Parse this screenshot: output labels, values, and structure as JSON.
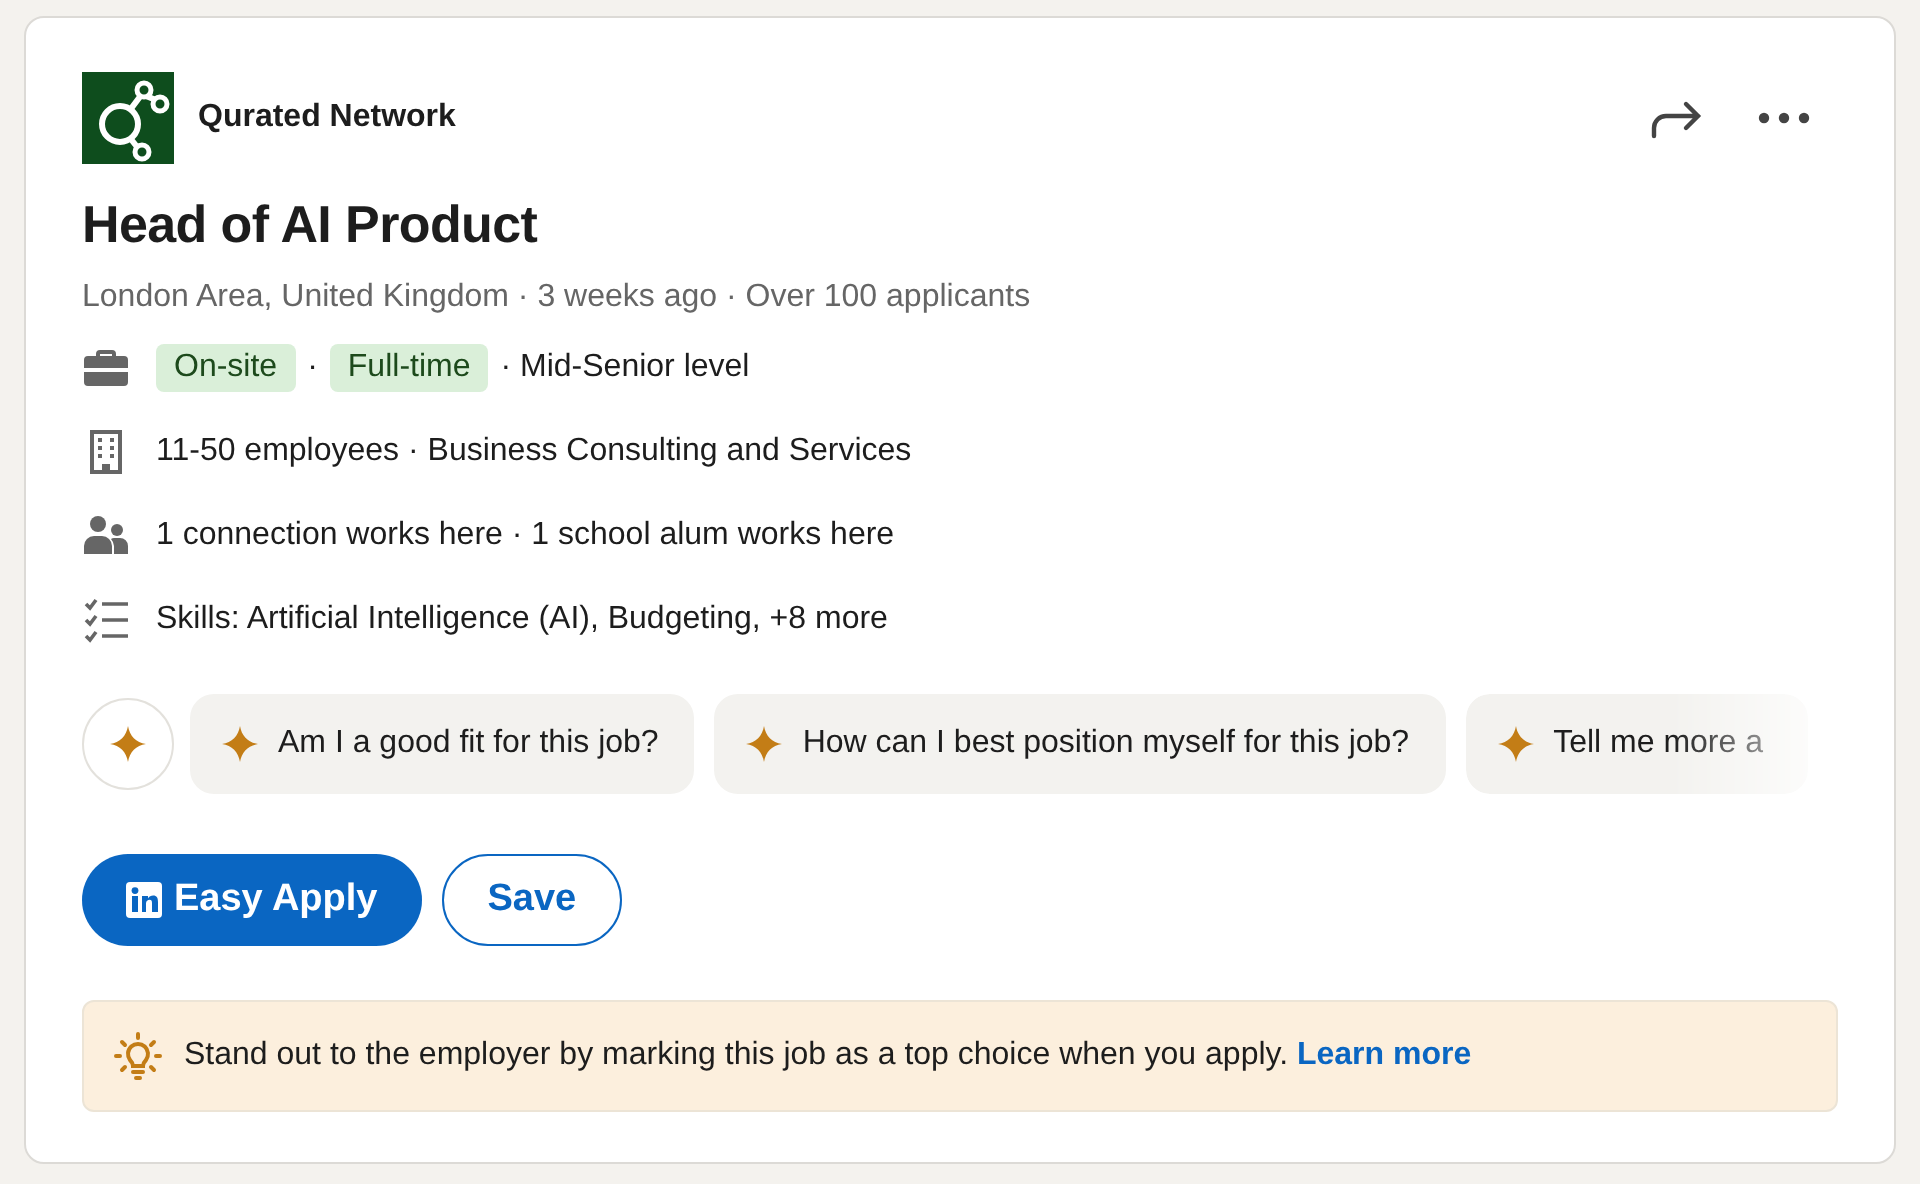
{
  "company": {
    "name": "Qurated Network"
  },
  "title": "Head of AI Product",
  "meta": "London Area, United Kingdom · 3 weeks ago · Over 100 applicants",
  "insights": [
    {
      "kind": "job-type",
      "parts": [
        {
          "text": "On-site",
          "tag": true
        },
        {
          "text": "·",
          "tag": false
        },
        {
          "text": "Full-time",
          "tag": true
        },
        {
          "text": "· Mid-Senior level",
          "tag": false
        }
      ]
    },
    {
      "kind": "company-size",
      "parts": [
        {
          "text": "11-50 employees · Business Consulting and Services",
          "tag": false
        }
      ]
    },
    {
      "kind": "connections",
      "parts": [
        {
          "text": "1 connection works here · 1 school alum works here",
          "tag": false
        }
      ]
    },
    {
      "kind": "skills",
      "parts": [
        {
          "text": "Skills: Artificial Intelligence (AI), Budgeting, +8 more",
          "tag": false
        }
      ]
    }
  ],
  "prompts": [
    {
      "text": "Am I a good fit for this job?",
      "cut": false
    },
    {
      "text": "How can I best position myself for this job?",
      "cut": false
    },
    {
      "text": "Tell me more a",
      "cut": true
    }
  ],
  "buttons": [
    {
      "label": "Easy Apply",
      "kind": "primary"
    },
    {
      "label": "Save",
      "kind": "secondary"
    }
  ],
  "banner": {
    "text": "Stand out to the employer by marking this job as a top choice when you apply.",
    "link": "Learn more"
  }
}
